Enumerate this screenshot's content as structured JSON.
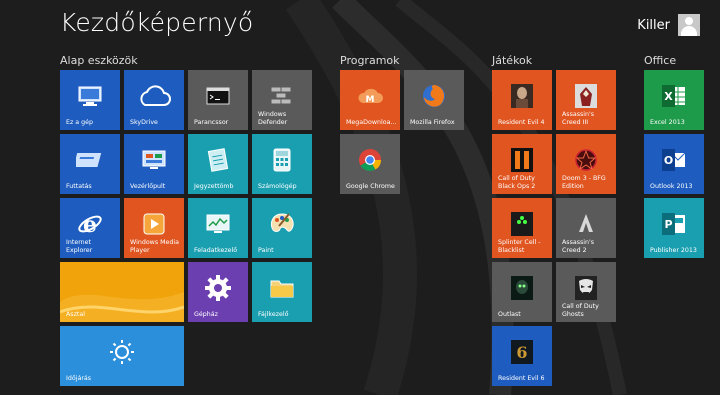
{
  "screen": {
    "title": "Kezdőképernyő"
  },
  "user": {
    "name": "Killer"
  },
  "groups": [
    {
      "label": "Alap eszközök",
      "tiles": [
        {
          "label": "Ez a gép",
          "color": "#1e5dbf",
          "icon": "computer-icon"
        },
        {
          "label": "SkyDrive",
          "color": "#1e5dbf",
          "icon": "cloud-icon"
        },
        {
          "label": "Parancssor",
          "color": "#5a5a5a",
          "icon": "command-prompt-icon"
        },
        {
          "label": "Windows Defender",
          "color": "#5a5a5a",
          "icon": "defender-wall-icon"
        },
        {
          "label": "Futtatás",
          "color": "#1e5dbf",
          "icon": "run-icon"
        },
        {
          "label": "Vezérlőpult",
          "color": "#1e5dbf",
          "icon": "control-panel-icon"
        },
        {
          "label": "Jegyzettömb",
          "color": "#1a9fb0",
          "icon": "notepad-icon"
        },
        {
          "label": "Számológép",
          "color": "#1a9fb0",
          "icon": "calculator-icon"
        },
        {
          "label": "Internet Explorer",
          "color": "#1e5dbf",
          "icon": "internet-explorer-icon"
        },
        {
          "label": "Windows Media Player",
          "color": "#e05520",
          "icon": "media-player-icon"
        },
        {
          "label": "Feladatkezelő",
          "color": "#1a9fb0",
          "icon": "task-manager-icon"
        },
        {
          "label": "Paint",
          "color": "#1a9fb0",
          "icon": "paint-palette-icon"
        },
        {
          "label": "Asztal",
          "color": "#f0a30a",
          "icon": ""
        },
        {
          "label": "Gépház",
          "color": "#6b3fb0",
          "icon": "gear-icon"
        },
        {
          "label": "Fájlkezelő",
          "color": "#1a9fb0",
          "icon": "folder-icon"
        },
        {
          "label": "Időjárás",
          "color": "#2b8fdc",
          "icon": "sun-icon"
        }
      ]
    },
    {
      "label": "Programok",
      "tiles": [
        {
          "label": "MegaDownloa...",
          "color": "#e05520",
          "icon": "mega-logo-icon"
        },
        {
          "label": "Mozilla Firefox",
          "color": "#5a5a5a",
          "icon": "firefox-icon"
        },
        {
          "label": "Google Chrome",
          "color": "#5a5a5a",
          "icon": "chrome-icon"
        }
      ]
    },
    {
      "label": "Játékok",
      "tiles": [
        {
          "label": "Resident Evil 4",
          "color": "#e05520",
          "icon": "resident-evil-4-icon"
        },
        {
          "label": "Assassin's Creed III",
          "color": "#e05520",
          "icon": "assassins-creed-3-icon"
        },
        {
          "label": "Call of Duty Black Ops 2",
          "color": "#e05520",
          "icon": "black-ops-2-icon"
        },
        {
          "label": "Doom 3 - BFG Edition",
          "color": "#e05520",
          "icon": "doom-3-icon"
        },
        {
          "label": "Splinter Cell - Blacklist",
          "color": "#e05520",
          "icon": "splinter-cell-icon"
        },
        {
          "label": "Assassin's Creed 2",
          "color": "#5a5a5a",
          "icon": "assassins-creed-2-icon"
        },
        {
          "label": "Outlast",
          "color": "#5a5a5a",
          "icon": "outlast-icon"
        },
        {
          "label": "Call of Duty Ghosts",
          "color": "#5a5a5a",
          "icon": "cod-ghosts-icon"
        },
        {
          "label": "Resident Evil 6",
          "color": "#1e5dbf",
          "icon": "resident-evil-6-icon"
        }
      ]
    },
    {
      "label": "Office",
      "tiles": [
        {
          "label": "Excel 2013",
          "color": "#1e9b4a",
          "icon": "excel-icon"
        },
        {
          "label": "Outlook 2013",
          "color": "#1e5dbf",
          "icon": "outlook-icon"
        },
        {
          "label": "Publisher 2013",
          "color": "#1a9fb0",
          "icon": "publisher-icon"
        }
      ]
    }
  ]
}
